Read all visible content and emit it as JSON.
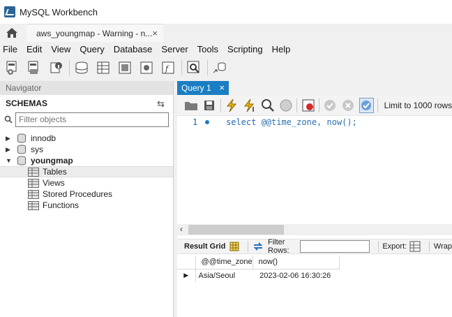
{
  "window": {
    "title": "MySQL Workbench"
  },
  "tabs": {
    "connection_label": "aws_youngmap - Warning - n...",
    "close_glyph": "×"
  },
  "menu": [
    "File",
    "Edit",
    "View",
    "Query",
    "Database",
    "Server",
    "Tools",
    "Scripting",
    "Help"
  ],
  "navigator": {
    "header": "Navigator",
    "schemas_label": "SCHEMAS",
    "filter_placeholder": "Filter objects",
    "schemas": [
      {
        "name": "innodb",
        "expanded": false
      },
      {
        "name": "sys",
        "expanded": false
      },
      {
        "name": "youngmap",
        "expanded": true
      }
    ],
    "children": [
      "Tables",
      "Views",
      "Stored Procedures",
      "Functions"
    ]
  },
  "query_tab": {
    "label": "Query 1",
    "close_glyph": "×"
  },
  "query_toolbar": {
    "limit_label": "Limit to 1000 rows"
  },
  "editor": {
    "line_number": "1",
    "keyword": "select",
    "rest": " @@time_zone, now();"
  },
  "result": {
    "grid_label": "Result Grid",
    "filter_label": "Filter Rows:",
    "export_label": "Export:",
    "wrap_label": "Wrap",
    "columns": [
      "@@time_zone",
      "now()"
    ],
    "rows": [
      [
        "Asia/Seoul",
        "2023-02-06 16:30:26"
      ]
    ]
  },
  "colors": {
    "accent": "#1b7ec2",
    "keyword": "#2a64b8"
  }
}
